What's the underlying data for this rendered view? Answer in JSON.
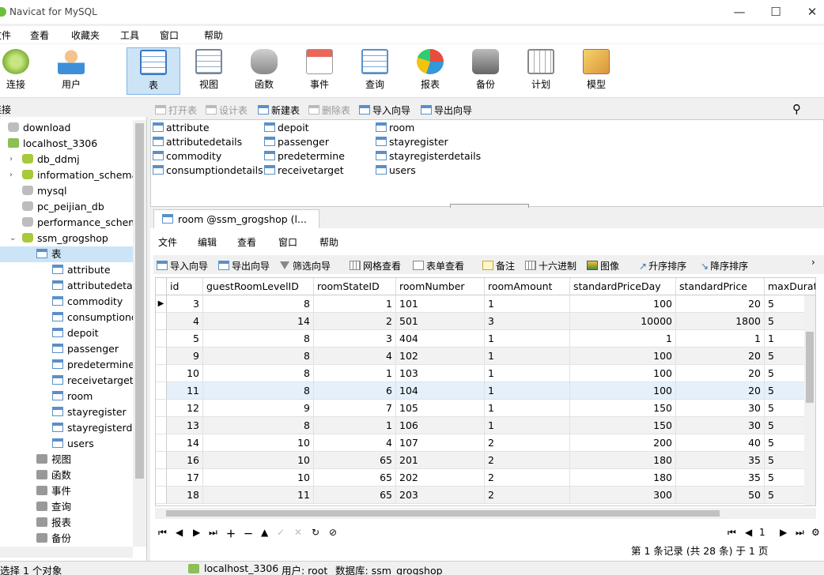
{
  "window": {
    "title": "Navicat for MySQL",
    "minimize": "—",
    "maximize": "☐",
    "close": "✕"
  },
  "menu": [
    "文件",
    "查看",
    "收藏夹",
    "工具",
    "窗口",
    "帮助"
  ],
  "toolbar": [
    "连接",
    "用户",
    "表",
    "视图",
    "函数",
    "事件",
    "查询",
    "报表",
    "备份",
    "计划",
    "模型"
  ],
  "sidebar": {
    "header": "连接",
    "tree": [
      {
        "label": "download",
        "icon": "database-gray-icon"
      },
      {
        "label": "localhost_3306",
        "icon": "connection-icon"
      },
      {
        "label": "db_ddmj",
        "icon": "database-icon"
      },
      {
        "label": "information_schema",
        "icon": "database-icon"
      },
      {
        "label": "mysql",
        "icon": "database-gray-icon"
      },
      {
        "label": "pc_peijian_db",
        "icon": "database-gray-icon"
      },
      {
        "label": "performance_schema",
        "icon": "database-gray-icon"
      },
      {
        "label": "ssm_grogshop",
        "icon": "database-icon"
      },
      {
        "label": "表",
        "icon": "table-folder-icon"
      },
      {
        "label": "attribute",
        "icon": "table-icon"
      },
      {
        "label": "attributedetails",
        "icon": "table-icon"
      },
      {
        "label": "commodity",
        "icon": "table-icon"
      },
      {
        "label": "consumptiondetails",
        "icon": "table-icon"
      },
      {
        "label": "depoit",
        "icon": "table-icon"
      },
      {
        "label": "passenger",
        "icon": "table-icon"
      },
      {
        "label": "predetermine",
        "icon": "table-icon"
      },
      {
        "label": "receivetarget",
        "icon": "table-icon"
      },
      {
        "label": "room",
        "icon": "table-icon"
      },
      {
        "label": "stayregister",
        "icon": "table-icon"
      },
      {
        "label": "stayregisterdetails",
        "icon": "table-icon"
      },
      {
        "label": "users",
        "icon": "table-icon"
      },
      {
        "label": "视图",
        "icon": "view-icon"
      },
      {
        "label": "函数",
        "icon": "function-icon"
      },
      {
        "label": "事件",
        "icon": "event-icon"
      },
      {
        "label": "查询",
        "icon": "query-icon"
      },
      {
        "label": "报表",
        "icon": "report-icon"
      },
      {
        "label": "备份",
        "icon": "backup-icon"
      }
    ]
  },
  "objbar": [
    "打开表",
    "设计表",
    "新建表",
    "删除表",
    "导入向导",
    "导出向导"
  ],
  "objects": [
    "attribute",
    "attributedetails",
    "commodity",
    "consumptiondetails",
    "depoit",
    "passenger",
    "predetermine",
    "receivetarget",
    "room",
    "stayregister",
    "stayregisterdetails",
    "users"
  ],
  "tab": {
    "label": "room @ssm_grogshop (l..."
  },
  "inner_menu": [
    "文件",
    "编辑",
    "查看",
    "窗口",
    "帮助"
  ],
  "inner_toolbar": [
    "导入向导",
    "导出向导",
    "筛选向导",
    "网格查看",
    "表单查看",
    "备注",
    "十六进制",
    "图像",
    "升序排序",
    "降序排序"
  ],
  "grid": {
    "columns": [
      "id",
      "guestRoomLevelID",
      "roomStateID",
      "roomNumber",
      "roomAmount",
      "standardPriceDay",
      "standardPrice",
      "maxDuratic"
    ],
    "rows": [
      [
        "3",
        "8",
        "1",
        "101",
        "1",
        "100",
        "20",
        "5"
      ],
      [
        "4",
        "14",
        "2",
        "501",
        "3",
        "10000",
        "1800",
        "5"
      ],
      [
        "5",
        "8",
        "3",
        "404",
        "1",
        "1",
        "1",
        "1"
      ],
      [
        "9",
        "8",
        "4",
        "102",
        "1",
        "100",
        "20",
        "5"
      ],
      [
        "10",
        "8",
        "1",
        "103",
        "1",
        "100",
        "20",
        "5"
      ],
      [
        "11",
        "8",
        "6",
        "104",
        "1",
        "100",
        "20",
        "5"
      ],
      [
        "12",
        "9",
        "7",
        "105",
        "1",
        "150",
        "30",
        "5"
      ],
      [
        "13",
        "8",
        "1",
        "106",
        "1",
        "150",
        "30",
        "5"
      ],
      [
        "14",
        "10",
        "4",
        "107",
        "2",
        "200",
        "40",
        "5"
      ],
      [
        "16",
        "10",
        "65",
        "201",
        "2",
        "180",
        "35",
        "5"
      ],
      [
        "17",
        "10",
        "65",
        "202",
        "2",
        "180",
        "35",
        "5"
      ],
      [
        "18",
        "11",
        "65",
        "203",
        "2",
        "300",
        "50",
        "5"
      ]
    ]
  },
  "record_info": "第 1 条记录 (共 28 条) 于 1 页",
  "page_num": "1",
  "status": {
    "selection": "选择 1 个对象",
    "connection": "localhost_3306",
    "user": "用户: root",
    "database": "数据库: ssm_grogshop"
  }
}
